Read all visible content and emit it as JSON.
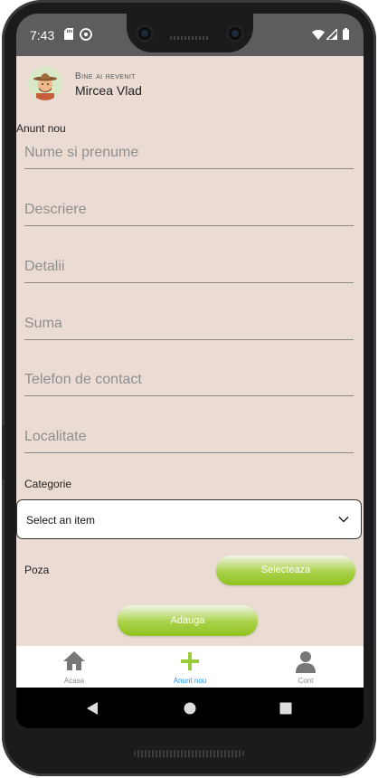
{
  "status_bar": {
    "time": "7:43"
  },
  "header": {
    "welcome": "Bine ai revenit",
    "user_name": "Mircea Vlad"
  },
  "form": {
    "title": "Anunt nou",
    "fields": [
      {
        "placeholder": "Nume si prenume",
        "value": ""
      },
      {
        "placeholder": "Descriere",
        "value": ""
      },
      {
        "placeholder": "Detalii",
        "value": ""
      },
      {
        "placeholder": "Suma",
        "value": ""
      },
      {
        "placeholder": "Telefon de contact",
        "value": ""
      },
      {
        "placeholder": "Localitate",
        "value": ""
      }
    ],
    "category_label": "Categorie",
    "category_select": "Select an item",
    "photo_label": "Poza",
    "select_button": "Selecteaza",
    "add_button": "Adauga"
  },
  "tabs": [
    {
      "label": "Acasa",
      "icon": "home-icon",
      "active": false
    },
    {
      "label": "Anunt nou",
      "icon": "plus-icon",
      "active": true
    },
    {
      "label": "Cont",
      "icon": "person-icon",
      "active": false
    }
  ],
  "colors": {
    "background": "#eadcd3",
    "accent": "#8fc21f",
    "active_tab": "#2196f3",
    "status_bar": "#5d5d5f"
  }
}
